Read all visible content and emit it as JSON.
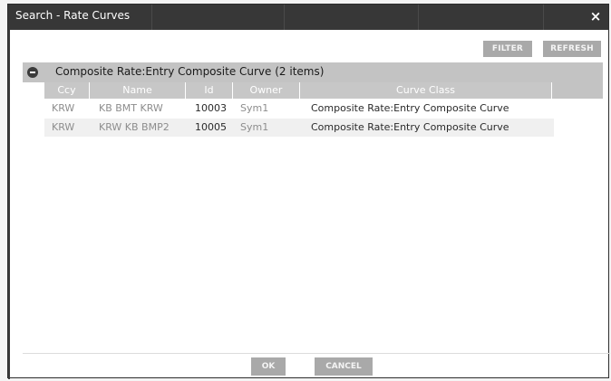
{
  "window": {
    "title": "Search - Rate Curves",
    "close_glyph": "×"
  },
  "toolbar": {
    "filter_label": "FILTER",
    "refresh_label": "REFRESH"
  },
  "group": {
    "label": "Composite Rate:Entry Composite Curve (2 items)"
  },
  "table": {
    "columns": [
      "Ccy",
      "Name",
      "Id",
      "Owner",
      "Curve Class"
    ],
    "rows": [
      {
        "ccy": "KRW",
        "name": "KB BMT KRW",
        "id": "10003",
        "owner": "Sym1",
        "curve_class": "Composite Rate:Entry Composite Curve"
      },
      {
        "ccy": "KRW",
        "name": "KRW KB BMP2",
        "id": "10005",
        "owner": "Sym1",
        "curve_class": "Composite Rate:Entry Composite Curve"
      }
    ]
  },
  "footer": {
    "ok_label": "OK",
    "cancel_label": "CANCEL"
  },
  "colors": {
    "titlebar": "#373737",
    "group_header": "#c3c3c3",
    "column_header": "#c7c7c7",
    "button": "#a9a9a9"
  }
}
